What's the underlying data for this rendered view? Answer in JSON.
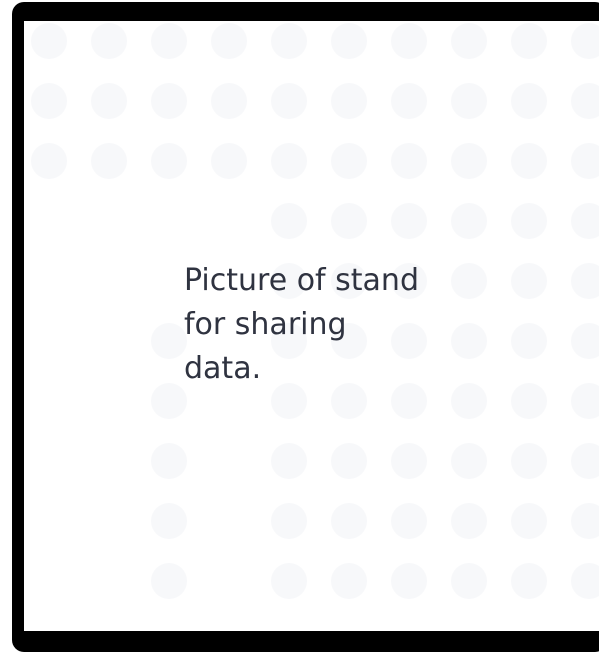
{
  "image_placeholder": {
    "caption": "Picture of stand\nfor sharing\ndata.",
    "colors": {
      "frame": "#000000",
      "background": "#ffffff",
      "dot": "#f7f8fa",
      "text": "#2f3340"
    }
  }
}
